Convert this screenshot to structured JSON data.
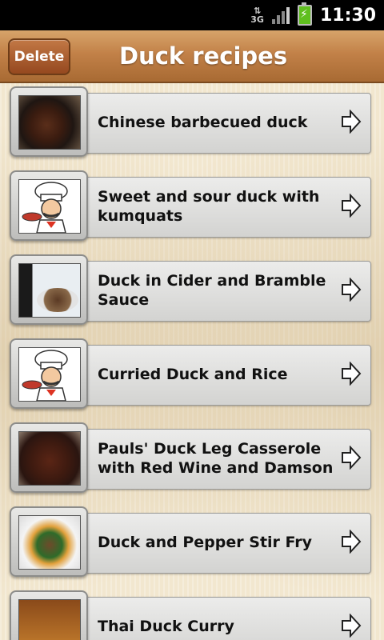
{
  "status_bar": {
    "network": "3G",
    "time": "11:30"
  },
  "header": {
    "delete_label": "Delete",
    "title": "Duck recipes"
  },
  "recipes": [
    {
      "title": "Chinese barbecued duck",
      "image": "barbecued-duck-photo"
    },
    {
      "title": "Sweet and sour duck with kumquats",
      "image": "chef-placeholder"
    },
    {
      "title": "Duck in Cider and Bramble Sauce",
      "image": "cider-duck-photo"
    },
    {
      "title": "Curried Duck and Rice",
      "image": "chef-placeholder"
    },
    {
      "title": "Pauls' Duck Leg Casserole with Red Wine and Damson",
      "image": "casserole-photo"
    },
    {
      "title": "Duck and Pepper Stir Fry",
      "image": "stir-fry-photo"
    },
    {
      "title": "Thai Duck Curry",
      "image": "thai-curry-photo"
    }
  ],
  "colors": {
    "header": "#c28148",
    "background": "#f1e6cc",
    "row": "#e0e0de"
  }
}
